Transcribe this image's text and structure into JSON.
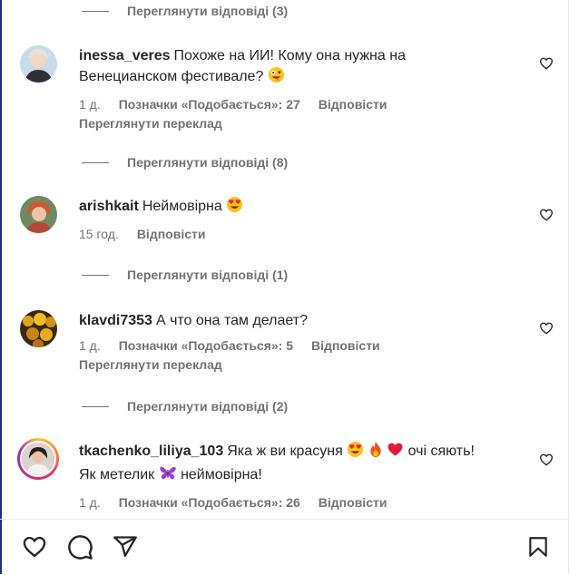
{
  "replies_links": [
    {
      "label": "Переглянути відповіді (3)"
    },
    {
      "label": "Переглянути відповіді (8)"
    },
    {
      "label": "Переглянути відповіді (1)"
    },
    {
      "label": "Переглянути відповіді (2)"
    }
  ],
  "comments": [
    {
      "username": "inessa_veres",
      "text_line1": "Похоже на ИИ! Кому она нужна на",
      "text_line2": "Венецианском фестивале?",
      "time": "1 д.",
      "likes": "Позначки «Подобається»: 27",
      "reply": "Відповісти",
      "translate": "Переглянути переклад"
    },
    {
      "username": "arishkait",
      "text_line1": "Неймовірна",
      "time": "15 год.",
      "reply": "Відповісти"
    },
    {
      "username": "klavdi7353",
      "text_line1": "А что она там делает?",
      "time": "1 д.",
      "likes": "Позначки «Подобається»: 5",
      "reply": "Відповісти",
      "translate": "Переглянути переклад"
    },
    {
      "username": "tkachenko_liliya_103",
      "text_a": "Яка ж ви красуня",
      "text_b": "очі сяють!",
      "text_line2_a": "Як метелик",
      "text_line2_b": "неймовірна!",
      "time": "1 д.",
      "likes": "Позначки «Подобається»: 26",
      "reply": "Відповісти"
    }
  ],
  "icons": {
    "like": "heart-icon",
    "comment": "comment-icon",
    "share": "share-icon",
    "save": "bookmark-icon"
  }
}
